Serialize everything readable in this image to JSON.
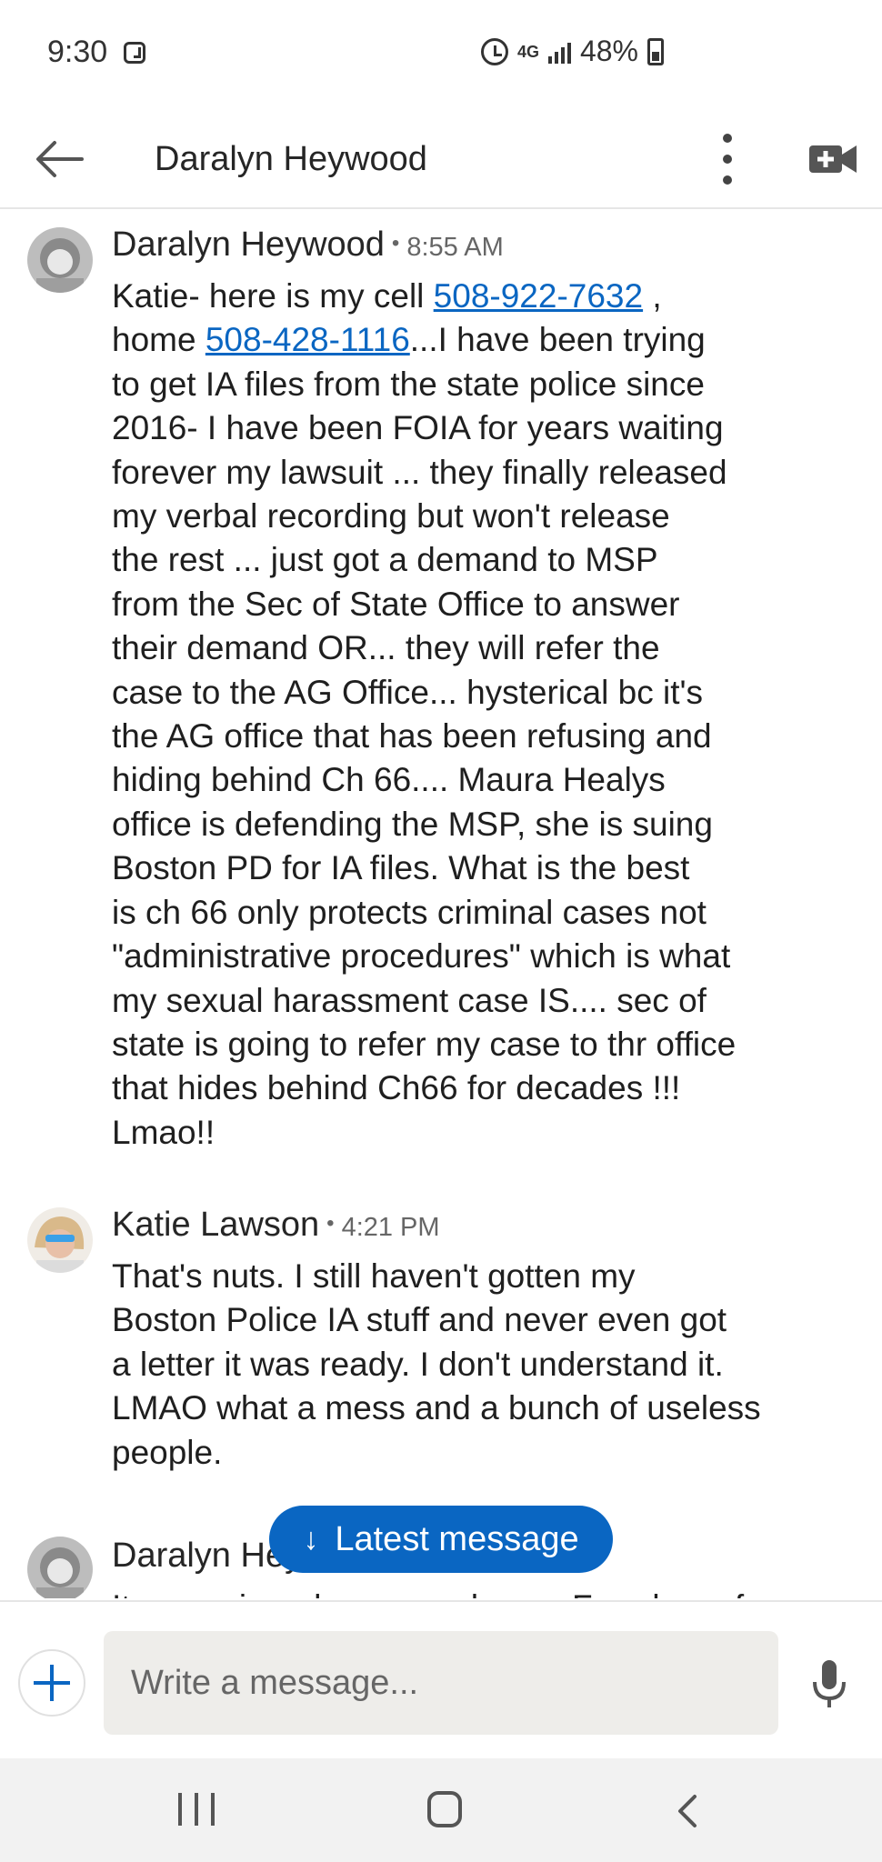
{
  "status_bar": {
    "time": "9:30",
    "network": "4G",
    "battery": "48%"
  },
  "header": {
    "title": "Daralyn Heywood"
  },
  "messages": [
    {
      "sender": "Daralyn Heywood",
      "time": "8:55 AM",
      "lines": [
        [
          "Katie- here is my cell ",
          {
            "link": "508-922-7632"
          },
          " ,"
        ],
        [
          "home ",
          {
            "link": "508-428-1116"
          },
          "...I have been trying"
        ],
        [
          "to get IA files from the state police since"
        ],
        [
          "2016- I have been FOIA for years waiting"
        ],
        [
          "forever my lawsuit ... they finally released"
        ],
        [
          "my verbal recording but won't release"
        ],
        [
          "the rest ... just got a demand to MSP"
        ],
        [
          "from the Sec of State Office to answer"
        ],
        [
          "their demand OR... they will refer the"
        ],
        [
          "case to the AG Office... hysterical bc it's"
        ],
        [
          "the AG office that has been refusing and"
        ],
        [
          "hiding behind Ch 66.... Maura Healys"
        ],
        [
          "office is defending the MSP, she is suing"
        ],
        [
          "Boston PD for IA files. What is the best"
        ],
        [
          "is ch 66 only protects criminal cases not"
        ],
        [
          "\"administrative procedures\" which is what"
        ],
        [
          "my sexual harassment case IS.... sec of"
        ],
        [
          "state is going to refer my case to thr office"
        ],
        [
          "that hides behind Ch66 for decades !!!"
        ],
        [
          "Lmao!!"
        ]
      ]
    },
    {
      "sender": "Katie Lawson",
      "time": "4:21 PM",
      "lines": [
        [
          "That's nuts. I still haven't gotten my"
        ],
        [
          "Boston Police IA stuff and never even got"
        ],
        [
          "a letter it was ready. I don't understand it."
        ],
        [
          "LMAO what a mess and a bunch of useless"
        ],
        [
          "people."
        ]
      ]
    },
    {
      "sender": "Daralyn Heywood",
      "time": "",
      "lines": [
        [
          "Its amazing - have you done a Freedom of"
        ]
      ]
    }
  ],
  "latest_message": {
    "label": "Latest message",
    "icon": "arrow-down-icon"
  },
  "composer": {
    "placeholder": "Write a message..."
  },
  "icons": {
    "back": "back-arrow-icon",
    "more": "more-vertical-icon",
    "video": "video-call-icon",
    "add": "plus-icon",
    "mic": "microphone-icon"
  },
  "colors": {
    "accent": "#0a66c2",
    "link": "#0a66c2",
    "composer_bg": "#eeedea",
    "nav_bg": "#f2f2f2"
  }
}
